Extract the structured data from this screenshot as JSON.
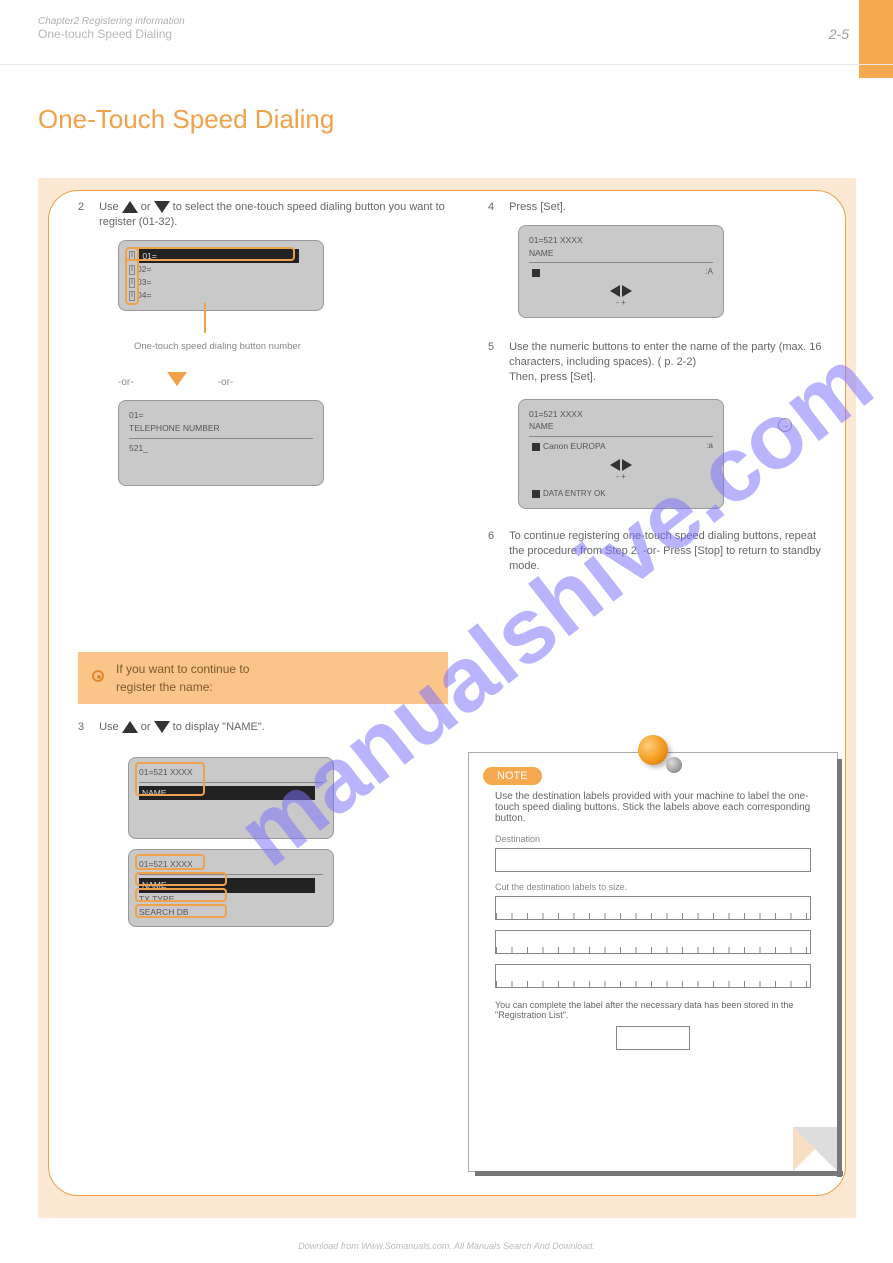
{
  "header": {
    "pretitle": "Chapter2 Registering information",
    "title": "One-touch Speed Dialing",
    "page": "2-5"
  },
  "chapter": "One-Touch Speed Dialing",
  "left": {
    "step2": {
      "num": "2",
      "prefix": "Use ",
      "mid": " or ",
      "suffix": " to select the one-touch speed dialing button you want to register (01-32)."
    },
    "lcd1": {
      "row": "01=",
      "r2": "02=",
      "r3": "03=",
      "r4": "04=",
      "callout": "One-touch speed dialing button number"
    },
    "lcd2": {
      "l1": "01=",
      "l2": "TELEPHONE NUMBER",
      "p": "521_"
    },
    "section": {
      "l1": "If you want to continue to",
      "l2": "register the name:"
    },
    "step3": {
      "num": "3",
      "prefix": "Use ",
      "mid": " or ",
      "suffix": " to display \"NAME\"."
    },
    "lcd3a": {
      "head": "01=521 XXXX",
      "sel": "NAME"
    },
    "lcd3b": {
      "head": "01=521 XXXX",
      "o1": "NAME",
      "o2": "TX TYPE",
      "o3": "SEARCH DB"
    }
  },
  "right": {
    "step4": {
      "num": "4",
      "body": "Press [Set]."
    },
    "lcd4": {
      "r1": "01=521 XXXX",
      "r2": "NAME",
      "p": "_",
      "hint": ":A",
      "lr": "-   +"
    },
    "step5": {
      "num": "5",
      "body": "Use the numeric buttons to enter the name of the party (max. 16 characters, including spaces). (",
      "crossref": "p. 2-2)",
      "after": "Then, press [Set]."
    },
    "lcd5": {
      "r1": "01=521 XXXX",
      "r2": "NAME",
      "val": "Canon EUROPA",
      "hint": ":a",
      "lr": "-   +",
      "foot": "DATA ENTRY OK"
    },
    "step6": {
      "num": "6",
      "body": "To continue registering one-touch speed dialing buttons, repeat the procedure from Step 2. -or- Press [Stop] to return to standby mode."
    }
  },
  "note": {
    "badge": "NOTE",
    "lead": "Use the destination labels provided with your machine to label the one-touch speed dialing buttons. Stick the labels above each corresponding button.",
    "dest": "Destination",
    "cut": "Cut the destination labels to size.",
    "foot": "You can complete the label after the necessary data has been stored in the \"Registration List\"."
  },
  "footer": "Download from Www.Somanuals.com. All Manuals Search And Download."
}
